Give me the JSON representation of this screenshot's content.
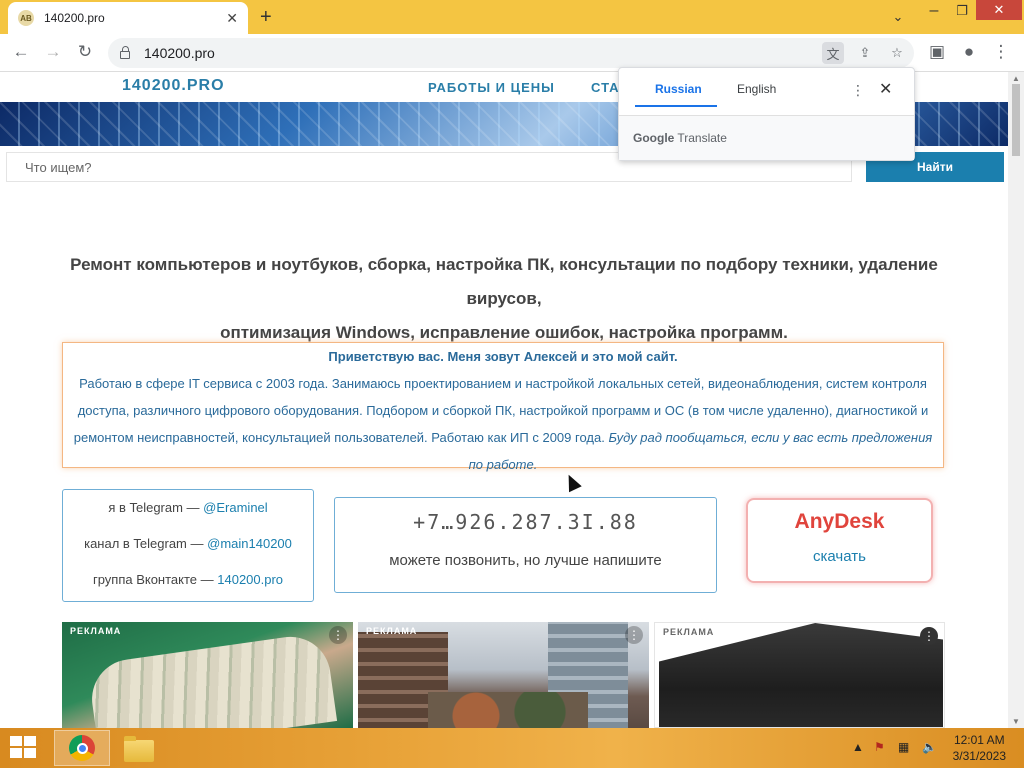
{
  "browser": {
    "tab_title": "140200.pro",
    "tab_favicon_text": "AB",
    "url": "140200.pro",
    "new_tab_symbol": "+",
    "close_tab_symbol": "✕"
  },
  "site": {
    "logo": "140200.PRO",
    "nav": [
      "РАБОТЫ И ЦЕНЫ",
      "СТАТ"
    ],
    "search_placeholder": "Что ищем?",
    "search_button": "Найти",
    "intro_line1": "Ремонт компьютеров и ноутбуков, сборка, настройка ПК, консультации по подбору техники, удаление вирусов,",
    "intro_line2": "оптимизация Windows, исправление ошибок, настройка программ.",
    "greeting_title": "Приветствую вас. Меня зовут Алексей и это мой сайт.",
    "greeting_text": "Работаю в сфере IT сервиса с 2003 года. Занимаюсь проектированием и настройкой локальных сетей, видеонаблюдения, систем контроля доступа, различного цифрового оборудования. Подбором и сборкой ПК, настройкой программ и ОС (в том числе удаленно), диагностикой и ремонтом неисправностей, консультацией пользователей. Работаю как ИП с 2009 года.",
    "greeting_italic": "Буду рад пообщаться, если у вас есть предложения по работе.",
    "contacts": [
      {
        "label": "я в Telegram — ",
        "link": "@Eraminel"
      },
      {
        "label": "канал в Telegram — ",
        "link": "@main140200"
      },
      {
        "label": "группа Вконтакте — ",
        "link": "140200.pro"
      }
    ],
    "phone": "+7…926.287.3I.88",
    "phone_caption": "можете позвонить, но лучше напишите",
    "anydesk_name": "AnyDesk",
    "anydesk_download": "скачать",
    "ads": [
      {
        "label": "РЕКЛАМА"
      },
      {
        "label": "РЕКЛАМА"
      },
      {
        "label": "РЕКЛАМА"
      }
    ]
  },
  "translate_popup": {
    "tab_active": "Russian",
    "tab_inactive": "English",
    "footer_brand": "Google",
    "footer_text": "Translate"
  },
  "taskbar": {
    "time": "12:01 AM",
    "date": "3/31/2023"
  }
}
